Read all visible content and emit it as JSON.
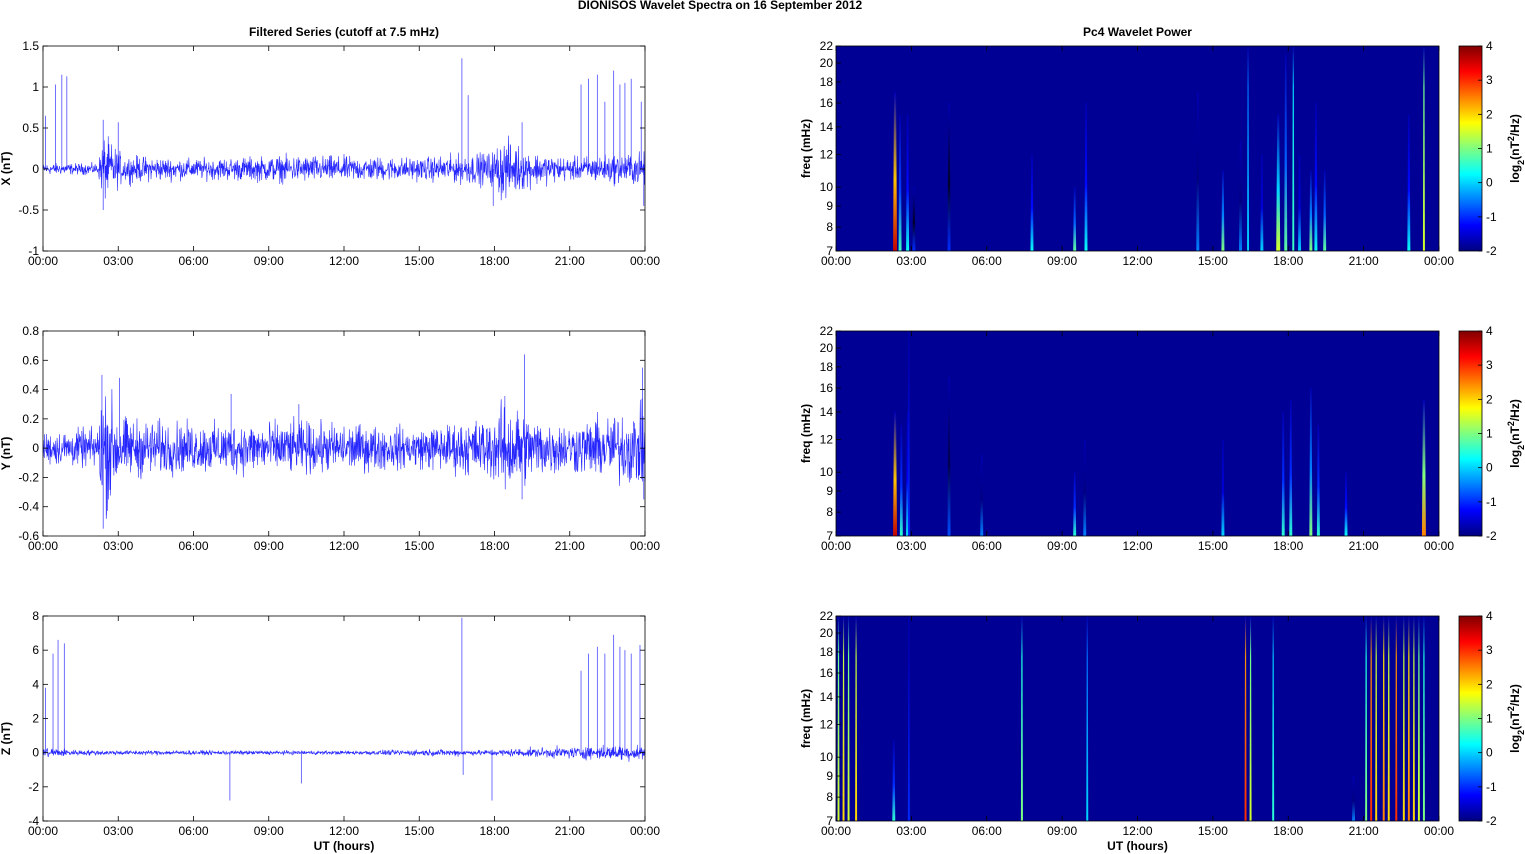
{
  "figure_title": "DIONISOS Wavelet Spectra on 16 September 2012",
  "colors": {
    "trace": "#0000ff",
    "axis": "#000000"
  },
  "chart_data": [
    {
      "type": "line",
      "panel": "x-series",
      "title": "Filtered Series (cutoff at 7.5 mHz)",
      "ylabel": "X (nT)",
      "xlabel": "",
      "xlim": [
        0,
        24
      ],
      "ylim": [
        -1,
        1.5
      ],
      "xticks": [
        0,
        3,
        6,
        9,
        12,
        15,
        18,
        21,
        24
      ],
      "xtick_labels": [
        "00:00",
        "03:00",
        "06:00",
        "09:00",
        "12:00",
        "15:00",
        "18:00",
        "21:00",
        "00:00"
      ],
      "yticks": [
        -1,
        -0.5,
        0,
        0.5,
        1,
        1.5
      ],
      "ytick_labels": [
        "-1",
        "-0.5",
        "0",
        "0.5",
        "1",
        "1.5"
      ],
      "noise_envelope": [
        [
          0,
          0.05
        ],
        [
          2.2,
          0.05
        ],
        [
          2.4,
          0.3
        ],
        [
          3.2,
          0.12
        ],
        [
          6,
          0.09
        ],
        [
          10,
          0.12
        ],
        [
          15,
          0.1
        ],
        [
          17.9,
          0.15
        ],
        [
          18.3,
          0.28
        ],
        [
          19.5,
          0.15
        ],
        [
          21,
          0.1
        ],
        [
          24,
          0.15
        ]
      ],
      "spikes": [
        [
          0.1,
          0.65
        ],
        [
          0.5,
          1.03
        ],
        [
          0.75,
          1.15
        ],
        [
          0.95,
          1.13
        ],
        [
          2.4,
          0.6
        ],
        [
          2.4,
          -0.5
        ],
        [
          3.0,
          0.57
        ],
        [
          16.7,
          1.35
        ],
        [
          16.95,
          0.9
        ],
        [
          17.95,
          -0.45
        ],
        [
          19.1,
          0.57
        ],
        [
          21.45,
          1.03
        ],
        [
          21.75,
          1.1
        ],
        [
          22.1,
          1.15
        ],
        [
          22.4,
          0.82
        ],
        [
          22.75,
          1.2
        ],
        [
          23.0,
          1.03
        ],
        [
          23.2,
          1.05
        ],
        [
          23.45,
          1.1
        ],
        [
          23.85,
          0.82
        ],
        [
          23.95,
          -0.45
        ]
      ]
    },
    {
      "type": "line",
      "panel": "y-series",
      "title": "",
      "ylabel": "Y (nT)",
      "xlabel": "",
      "xlim": [
        0,
        24
      ],
      "ylim": [
        -0.6,
        0.8
      ],
      "xticks": [
        0,
        3,
        6,
        9,
        12,
        15,
        18,
        21,
        24
      ],
      "xtick_labels": [
        "00:00",
        "03:00",
        "06:00",
        "09:00",
        "12:00",
        "15:00",
        "18:00",
        "21:00",
        "00:00"
      ],
      "yticks": [
        -0.6,
        -0.4,
        -0.2,
        0,
        0.2,
        0.4,
        0.6,
        0.8
      ],
      "ytick_labels": [
        "-0.6",
        "-0.4",
        "-0.2",
        "0",
        "0.2",
        "0.4",
        "0.6",
        "0.8"
      ],
      "noise_envelope": [
        [
          0,
          0.08
        ],
        [
          2.2,
          0.1
        ],
        [
          2.4,
          0.35
        ],
        [
          3.2,
          0.15
        ],
        [
          6,
          0.12
        ],
        [
          10,
          0.13
        ],
        [
          15,
          0.1
        ],
        [
          17.9,
          0.15
        ],
        [
          18.5,
          0.25
        ],
        [
          19.5,
          0.15
        ],
        [
          21,
          0.12
        ],
        [
          24,
          0.2
        ]
      ],
      "spikes": [
        [
          2.35,
          0.5
        ],
        [
          2.4,
          -0.55
        ],
        [
          3.05,
          0.48
        ],
        [
          7.5,
          0.37
        ],
        [
          10.2,
          0.3
        ],
        [
          19.2,
          0.64
        ],
        [
          19.1,
          -0.35
        ],
        [
          23.9,
          0.55
        ],
        [
          23.95,
          -0.35
        ]
      ]
    },
    {
      "type": "line",
      "panel": "z-series",
      "title": "",
      "ylabel": "Z (nT)",
      "xlabel": "UT (hours)",
      "xlim": [
        0,
        24
      ],
      "ylim": [
        -4,
        8
      ],
      "xticks": [
        0,
        3,
        6,
        9,
        12,
        15,
        18,
        21,
        24
      ],
      "xtick_labels": [
        "00:00",
        "03:00",
        "06:00",
        "09:00",
        "12:00",
        "15:00",
        "18:00",
        "21:00",
        "00:00"
      ],
      "yticks": [
        -4,
        -2,
        0,
        2,
        4,
        6,
        8
      ],
      "ytick_labels": [
        "-4",
        "-2",
        "0",
        "2",
        "4",
        "6",
        "8"
      ],
      "noise_envelope": [
        [
          0,
          0.25
        ],
        [
          1.2,
          0.12
        ],
        [
          3,
          0.1
        ],
        [
          12,
          0.08
        ],
        [
          16.5,
          0.15
        ],
        [
          17,
          0.1
        ],
        [
          21,
          0.25
        ],
        [
          24,
          0.35
        ]
      ],
      "spikes": [
        [
          0.1,
          3.8
        ],
        [
          0.4,
          5.8
        ],
        [
          0.6,
          6.6
        ],
        [
          0.85,
          6.4
        ],
        [
          7.45,
          -2.8
        ],
        [
          10.3,
          -1.8
        ],
        [
          16.7,
          7.9
        ],
        [
          16.75,
          -1.3
        ],
        [
          17.9,
          -2.8
        ],
        [
          21.45,
          4.8
        ],
        [
          21.75,
          5.8
        ],
        [
          22.1,
          6.2
        ],
        [
          22.4,
          5.8
        ],
        [
          22.75,
          6.9
        ],
        [
          23.0,
          6.2
        ],
        [
          23.2,
          6.0
        ],
        [
          23.45,
          5.8
        ],
        [
          23.8,
          6.3
        ]
      ]
    },
    {
      "type": "heatmap",
      "panel": "x-wavelet",
      "title": "Pc4 Wavelet Power",
      "ylabel": "freq (mHz)",
      "xlabel": "",
      "xlim": [
        0,
        24
      ],
      "ylim": [
        7,
        22
      ],
      "yscale": "log",
      "yticks": [
        7,
        8,
        9,
        10,
        12,
        14,
        16,
        18,
        20,
        22
      ],
      "ytick_labels": [
        "7",
        "8",
        "9",
        "10",
        "12",
        "14",
        "16",
        "18",
        "20",
        "22"
      ],
      "xtick_labels": [
        "00:00",
        "03:00",
        "06:00",
        "09:00",
        "12:00",
        "15:00",
        "18:00",
        "21:00",
        "00:00"
      ],
      "colorbar": {
        "label_main": "log",
        "label_sub": "2",
        "label_rest": "(nT",
        "label_sup": "2",
        "label_end": "/Hz)",
        "clim": [
          -2,
          4
        ],
        "tick_labels": [
          "-2",
          "-1",
          "0",
          "1",
          "2",
          "3",
          "4"
        ]
      },
      "events": [
        [
          2.35,
          3.6,
          17
        ],
        [
          2.55,
          0.6,
          15
        ],
        [
          2.85,
          0.3,
          15
        ],
        [
          3.1,
          -1,
          10
        ],
        [
          4.5,
          -1,
          16
        ],
        [
          7.8,
          0.3,
          12
        ],
        [
          9.5,
          0.8,
          10
        ],
        [
          9.95,
          0.3,
          16
        ],
        [
          14.4,
          -0.5,
          17
        ],
        [
          15.4,
          1,
          11
        ],
        [
          16.1,
          -0.5,
          13
        ],
        [
          16.4,
          0,
          22
        ],
        [
          16.95,
          0,
          12
        ],
        [
          17.6,
          1.5,
          15
        ],
        [
          17.9,
          0.8,
          21
        ],
        [
          18.2,
          0.6,
          22
        ],
        [
          18.45,
          0,
          12
        ],
        [
          18.9,
          1,
          11
        ],
        [
          19.1,
          0.3,
          16
        ],
        [
          19.45,
          0.8,
          11
        ],
        [
          22.8,
          0.3,
          15
        ],
        [
          23.4,
          1.5,
          22
        ]
      ]
    },
    {
      "type": "heatmap",
      "panel": "y-wavelet",
      "title": "",
      "ylabel": "freq (mHz)",
      "xlabel": "",
      "xlim": [
        0,
        24
      ],
      "ylim": [
        7,
        22
      ],
      "yscale": "log",
      "yticks": [
        7,
        8,
        9,
        10,
        12,
        14,
        16,
        18,
        20,
        22
      ],
      "ytick_labels": [
        "7",
        "8",
        "9",
        "10",
        "12",
        "14",
        "16",
        "18",
        "20",
        "22"
      ],
      "xtick_labels": [
        "00:00",
        "03:00",
        "06:00",
        "09:00",
        "12:00",
        "15:00",
        "18:00",
        "21:00",
        "00:00"
      ],
      "colorbar": {
        "label_main": "log",
        "label_sub": "2",
        "label_rest": "(nT",
        "label_sup": "2",
        "label_end": "/Hz)",
        "clim": [
          -2,
          4
        ],
        "tick_labels": [
          "-2",
          "-1",
          "0",
          "1",
          "2",
          "3",
          "4"
        ]
      },
      "events": [
        [
          2.35,
          3.6,
          14
        ],
        [
          2.6,
          0.5,
          13
        ],
        [
          2.85,
          0.2,
          14
        ],
        [
          2.9,
          -1,
          22
        ],
        [
          4.5,
          -0.8,
          17
        ],
        [
          5.8,
          -0.5,
          11
        ],
        [
          9.5,
          0.5,
          10
        ],
        [
          9.9,
          -0.5,
          12
        ],
        [
          15.4,
          0,
          12
        ],
        [
          17.8,
          0.5,
          14
        ],
        [
          18.1,
          0.5,
          15
        ],
        [
          18.9,
          1,
          16
        ],
        [
          19.2,
          0.5,
          13
        ],
        [
          20.3,
          0.3,
          10
        ],
        [
          23.4,
          2.5,
          15
        ]
      ]
    },
    {
      "type": "heatmap",
      "panel": "z-wavelet",
      "title": "",
      "ylabel": "freq (mHz)",
      "xlabel": "UT (hours)",
      "xlim": [
        0,
        24
      ],
      "ylim": [
        7,
        22
      ],
      "yscale": "log",
      "yticks": [
        7,
        8,
        9,
        10,
        12,
        14,
        16,
        18,
        20,
        22
      ],
      "ytick_labels": [
        "7",
        "8",
        "9",
        "10",
        "12",
        "14",
        "16",
        "18",
        "20",
        "22"
      ],
      "xtick_labels": [
        "00:00",
        "03:00",
        "06:00",
        "09:00",
        "12:00",
        "15:00",
        "18:00",
        "21:00",
        "00:00"
      ],
      "colorbar": {
        "label_main": "log",
        "label_sub": "2",
        "label_rest": "(nT",
        "label_sup": "2",
        "label_end": "/Hz)",
        "clim": [
          -2,
          4
        ],
        "tick_labels": [
          "-2",
          "-1",
          "0",
          "1",
          "2",
          "3",
          "4"
        ]
      },
      "events": [
        [
          0.1,
          1.5,
          22
        ],
        [
          0.3,
          2,
          22
        ],
        [
          0.5,
          1.5,
          22
        ],
        [
          0.8,
          2,
          22
        ],
        [
          2.3,
          0.5,
          11
        ],
        [
          2.9,
          -1,
          22
        ],
        [
          7.4,
          1,
          22
        ],
        [
          10.0,
          0,
          22
        ],
        [
          16.3,
          3,
          22
        ],
        [
          16.5,
          1.5,
          22
        ],
        [
          17.4,
          0.5,
          22
        ],
        [
          20.6,
          -0.5,
          9
        ],
        [
          21.1,
          1,
          22
        ],
        [
          21.3,
          3,
          22
        ],
        [
          21.5,
          2,
          22
        ],
        [
          21.8,
          2.5,
          22
        ],
        [
          22.0,
          2,
          22
        ],
        [
          22.3,
          3,
          22
        ],
        [
          22.6,
          2,
          22
        ],
        [
          22.8,
          2.5,
          22
        ],
        [
          23.0,
          2,
          22
        ],
        [
          23.2,
          1.5,
          22
        ],
        [
          23.4,
          1,
          22
        ]
      ]
    }
  ]
}
